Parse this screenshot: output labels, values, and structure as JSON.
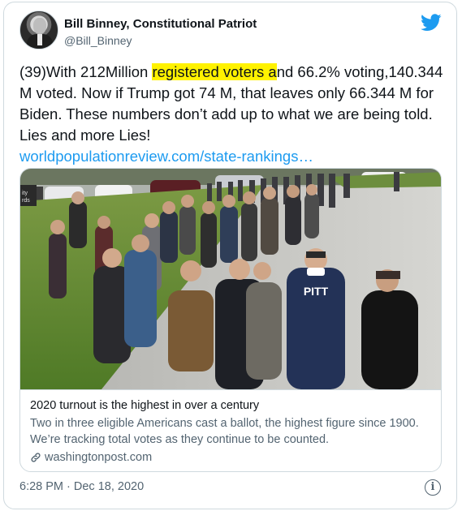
{
  "author": {
    "display_name": "Bill Binney, Constitutional Patriot",
    "handle": "@Bill_Binney"
  },
  "tweet": {
    "text_before_highlight": "(39)With 212Million ",
    "highlighted_text": "registered voters a",
    "text_after_highlight": "nd 66.2% voting,140.344 M voted.  Now if Trump got 74 M, that leaves only 66.344 M for Biden.  These numbers don’t add up to what we are being told. Lies and more Lies!",
    "link_text": "worldpopulationreview.com/state-rankings…",
    "highlight_color": "#fff200",
    "link_color": "#1d9bf0"
  },
  "card": {
    "image_description_icon": "photo-of-voters-line",
    "photo_sign_text": "ity\nrds",
    "sweatshirt_text": "PITT",
    "title": "2020 turnout is the highest in over a century",
    "description": "Two in three eligible Americans cast a ballot, the highest figure since 1900. We’re tracking total votes as they continue to be counted.",
    "domain": "washingtonpost.com"
  },
  "footer": {
    "timestamp": "6:28 PM · Dec 18, 2020",
    "info_icon": "i"
  },
  "icons": {
    "brand": "twitter-bird-icon",
    "brand_color": "#1d9bf0"
  }
}
